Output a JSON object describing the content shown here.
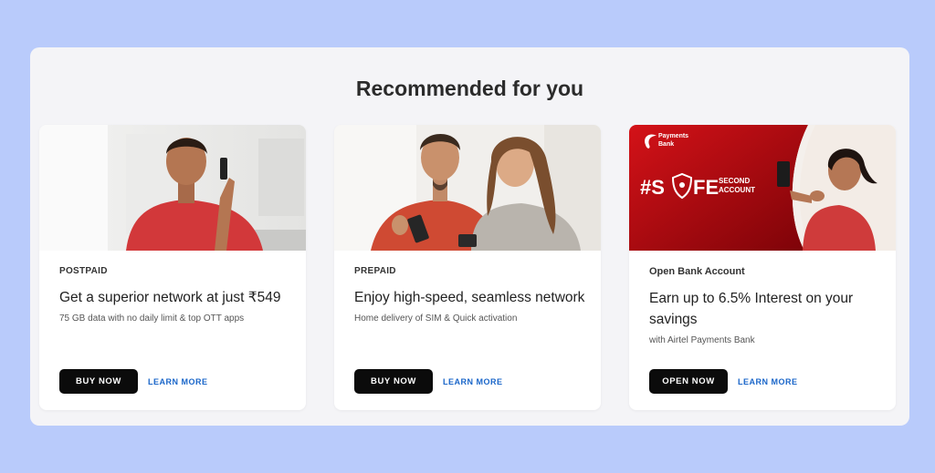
{
  "section": {
    "title": "Recommended for you"
  },
  "cards": [
    {
      "category": "POSTPAID",
      "headline": "Get a superior network at just ₹549",
      "description": "75 GB data with no daily limit & top OTT apps",
      "primary_button": "BUY NOW",
      "secondary_link": "LEARN MORE"
    },
    {
      "category": "PREPAID",
      "headline": "Enjoy high-speed, seamless network",
      "description": "Home delivery of SIM & Quick activation",
      "primary_button": "BUY NOW",
      "secondary_link": "LEARN MORE"
    },
    {
      "category": "Open Bank Account",
      "headline": "Earn up to 6.5% Interest on your savings",
      "description": "with Airtel Payments Bank",
      "primary_button": "OPEN NOW",
      "secondary_link": "LEARN MORE",
      "banner": {
        "brand_line1": "Payments",
        "brand_line2": "Bank",
        "hashtag_prefix": "#S",
        "hashtag_suffix": "FE",
        "tagline_line1": "SECOND",
        "tagline_line2": "ACCOUNT"
      }
    }
  ],
  "colors": {
    "page_background": "#b9cbfb",
    "panel_background": "#f4f4f7",
    "button_primary": "#0b0b0b",
    "link": "#1a66c9",
    "banner_red": "#b3060d"
  }
}
